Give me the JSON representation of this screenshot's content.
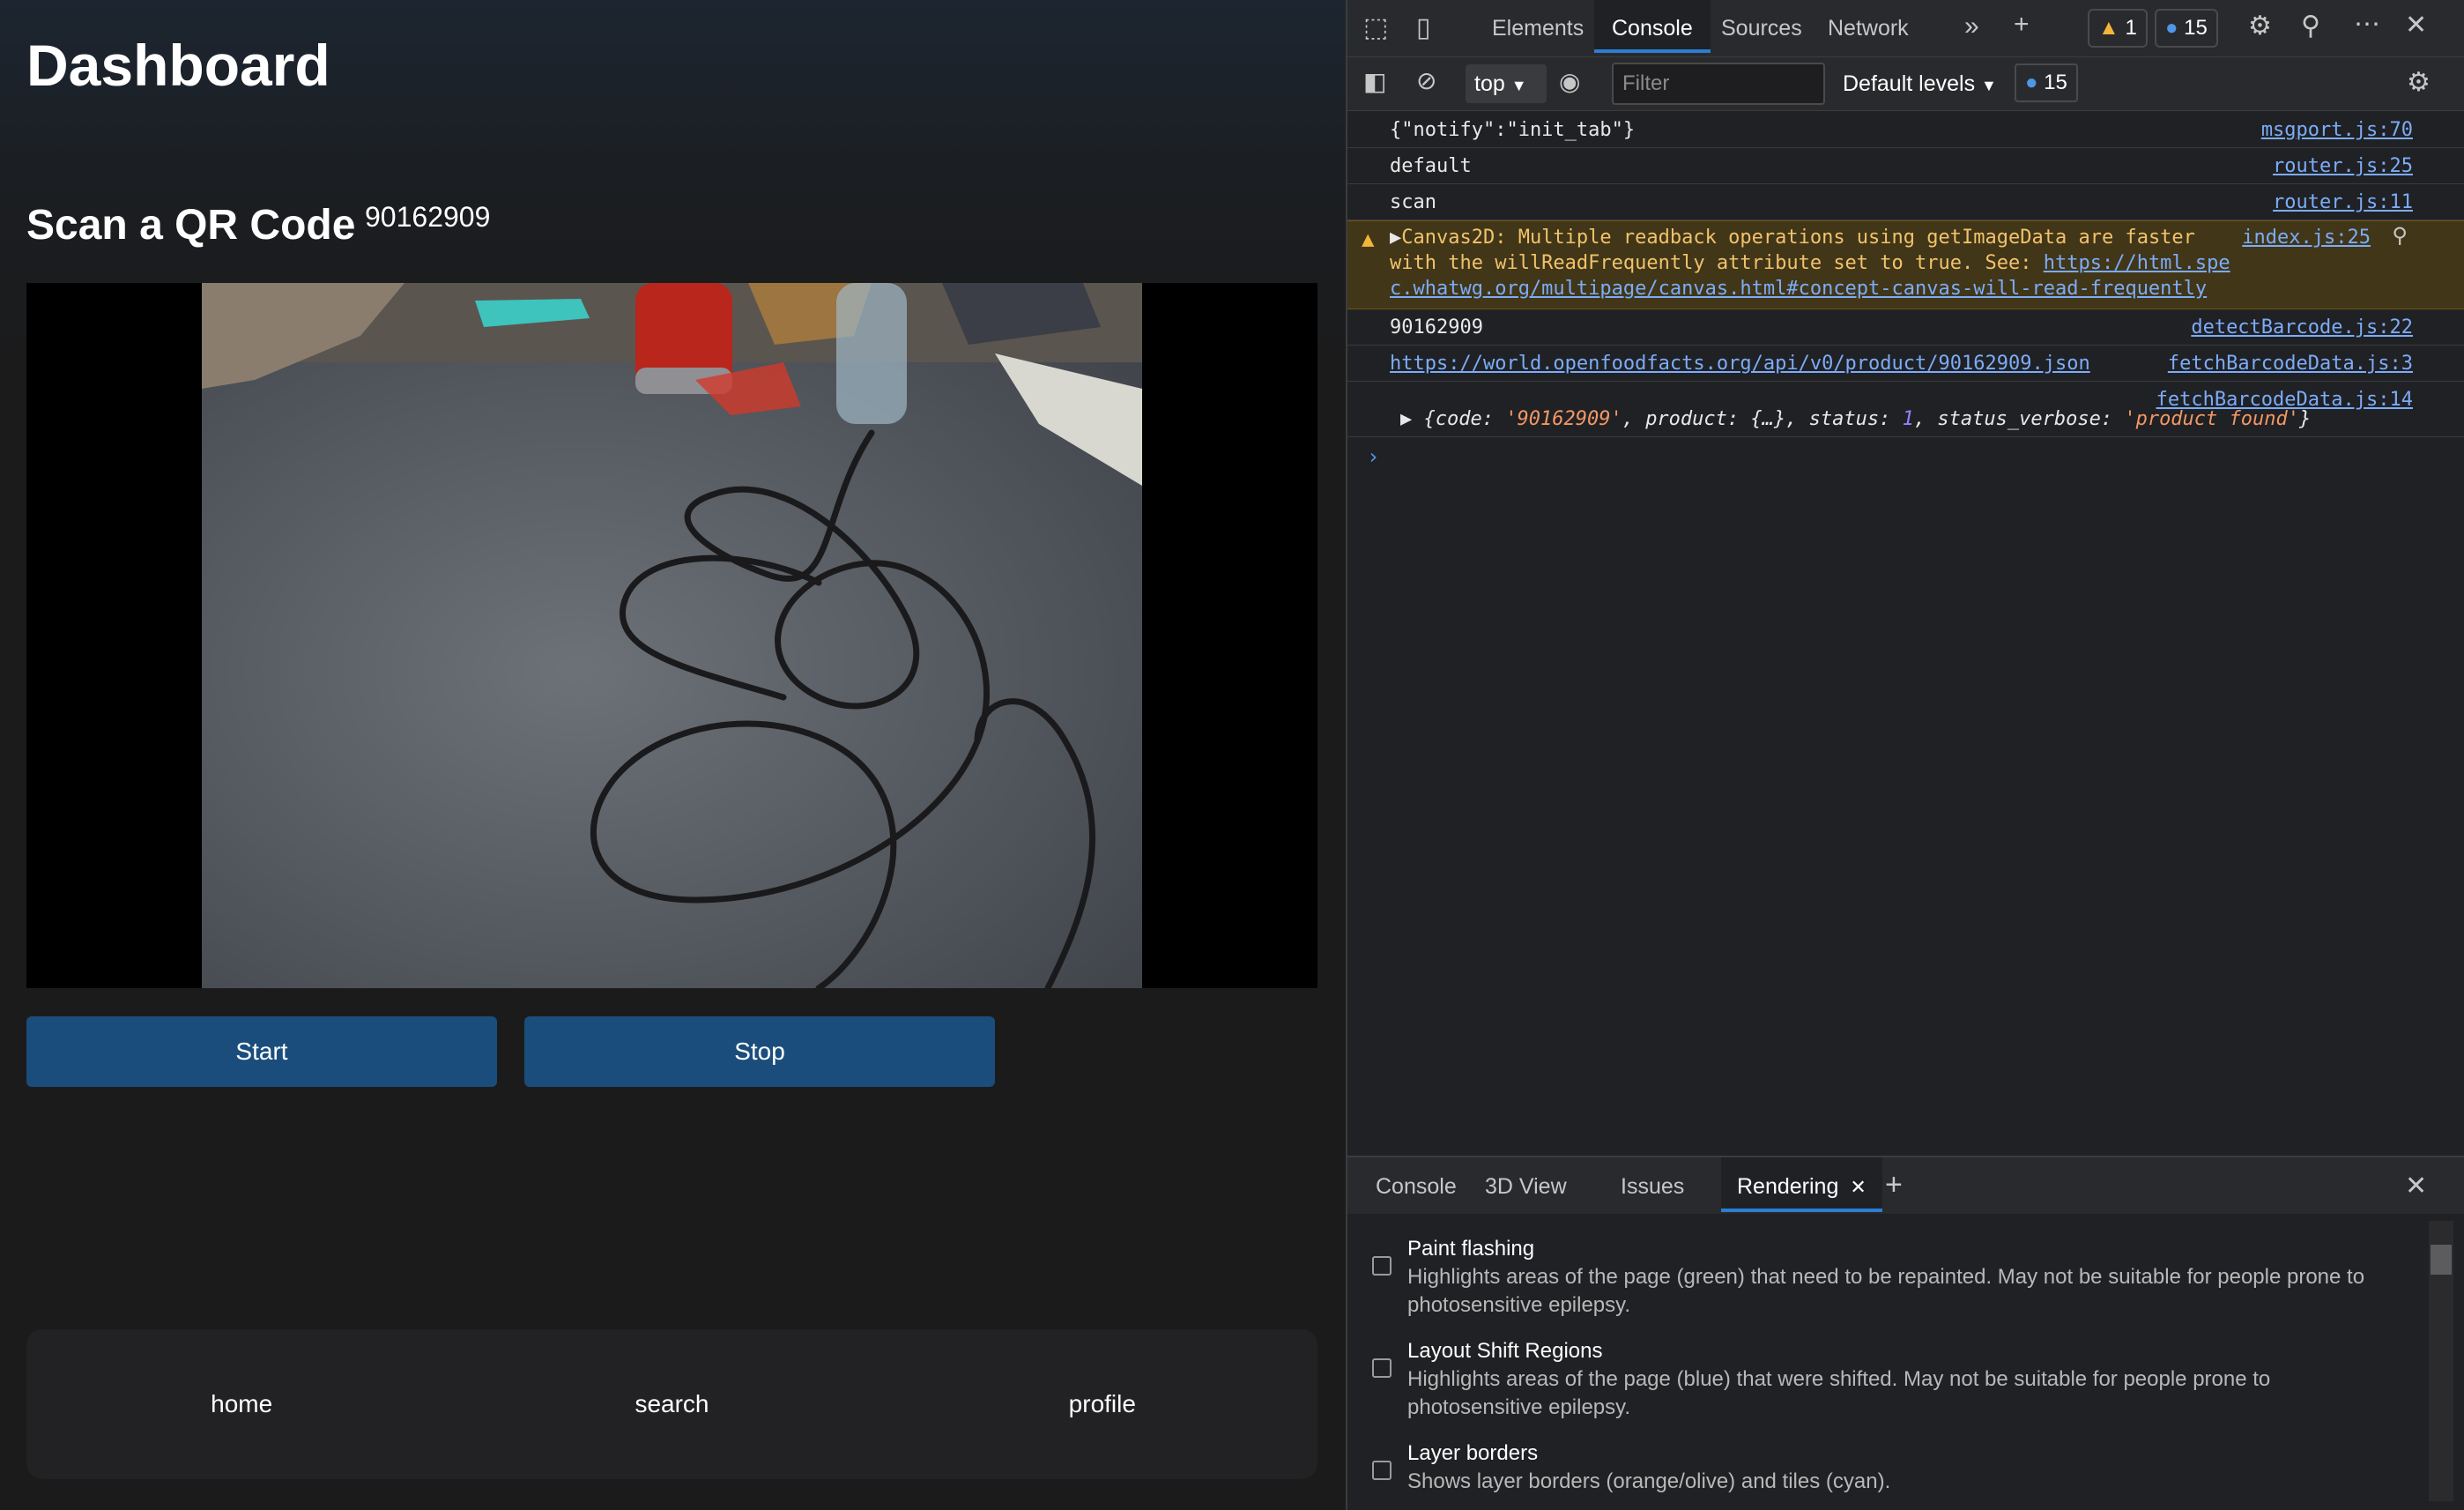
{
  "app": {
    "title": "Dashboard",
    "scan_title": "Scan a QR Code",
    "scanned_code": "90162909",
    "start_label": "Start",
    "stop_label": "Stop",
    "nav": [
      "home",
      "search",
      "profile"
    ]
  },
  "devtools": {
    "tabs": [
      "Elements",
      "Console",
      "Sources",
      "Network"
    ],
    "active_tab": "Console",
    "warnings_count": "1",
    "messages_count": "15",
    "context": "top",
    "filter_placeholder": "Filter",
    "levels": "Default levels",
    "toolbar_count": "15",
    "console": [
      {
        "msg": "{\"notify\":\"init_tab\"}",
        "src": "msgport.js:70"
      },
      {
        "msg": "default",
        "src": "router.js:25"
      },
      {
        "msg": "scan",
        "src": "router.js:11"
      },
      {
        "msg": "90162909",
        "src": "detectBarcode.js:22"
      },
      {
        "msg": "https://world.openfoodfacts.org/api/v0/product/90162909.json",
        "src": "fetchBarcodeData.js:3"
      },
      {
        "msg": "",
        "src": "fetchBarcodeData.js:14"
      }
    ],
    "warning": {
      "line1": "Canvas2D: Multiple readback operations using getImageData are faster",
      "line2_a": "with the willReadFrequently attribute set to true. See: ",
      "line2_link": "https://html.spe",
      "line3_link": "c.whatwg.org/multipage/canvas.html#concept-canvas-will-read-frequently",
      "src": "index.js:25"
    },
    "object_line": {
      "code_key": "code",
      "code_val": "'90162909'",
      "product_key": "product",
      "product_val": "{…}",
      "status_key": "status",
      "status_val": "1",
      "verbose_key": "status_verbose",
      "verbose_val": "'product found'"
    },
    "drawer_tabs": [
      "Console",
      "3D View",
      "Issues",
      "Rendering"
    ],
    "rendering_options": [
      {
        "title": "Paint flashing",
        "desc1": "Highlights areas of the page (green) that need to be repainted. May not be suitable for people prone to",
        "desc2": "photosensitive epilepsy."
      },
      {
        "title": "Layout Shift Regions",
        "desc1": "Highlights areas of the page (blue) that were shifted. May not be suitable for people prone to",
        "desc2": "photosensitive epilepsy."
      },
      {
        "title": "Layer borders",
        "desc1": "Shows layer borders (orange/olive) and tiles (cyan).",
        "desc2": ""
      }
    ],
    "colors": {
      "accent": "#2a7fd4",
      "button": "#1a4d7c",
      "warning_bg": "#413618",
      "link": "#7cacf8"
    }
  }
}
